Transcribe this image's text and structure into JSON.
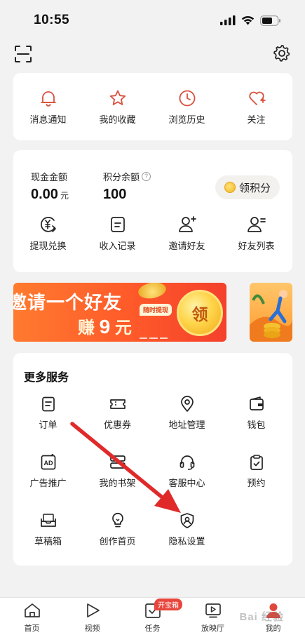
{
  "status_bar": {
    "time": "10:55"
  },
  "top_bar": {
    "scan_icon": "scan-icon",
    "settings_icon": "gear-icon"
  },
  "quick_actions": [
    {
      "label": "消息通知",
      "icon": "bell-icon"
    },
    {
      "label": "我的收藏",
      "icon": "star-icon"
    },
    {
      "label": "浏览历史",
      "icon": "clock-icon"
    },
    {
      "label": "关注",
      "icon": "heart-plus-icon"
    }
  ],
  "wallet": {
    "cash_label": "现金金额",
    "cash_value": "0.00",
    "cash_unit": "元",
    "points_label": "积分余额",
    "points_value": "100",
    "claim_button": "领积分",
    "actions": [
      {
        "label": "提现兑换",
        "icon": "yen-exchange-icon"
      },
      {
        "label": "收入记录",
        "icon": "record-icon"
      },
      {
        "label": "邀请好友",
        "icon": "add-user-icon"
      },
      {
        "label": "好友列表",
        "icon": "user-list-icon"
      }
    ]
  },
  "banner": {
    "title": "邀请一个好友",
    "earn_prefix": "赚",
    "earn_amount": "9",
    "earn_unit": "元",
    "tag": "随时提现",
    "coin_text": "领"
  },
  "more_services": {
    "title": "更多服务",
    "items": [
      {
        "label": "订单",
        "icon": "order-icon"
      },
      {
        "label": "优惠券",
        "icon": "coupon-icon"
      },
      {
        "label": "地址管理",
        "icon": "location-icon"
      },
      {
        "label": "钱包",
        "icon": "wallet-icon"
      },
      {
        "label": "广告推广",
        "icon": "ad-icon"
      },
      {
        "label": "我的书架",
        "icon": "bookshelf-icon"
      },
      {
        "label": "客服中心",
        "icon": "headset-icon"
      },
      {
        "label": "预约",
        "icon": "appointment-icon"
      },
      {
        "label": "草稿箱",
        "icon": "draft-box-icon"
      },
      {
        "label": "创作首页",
        "icon": "lightbulb-icon"
      },
      {
        "label": "隐私设置",
        "icon": "privacy-shield-icon"
      }
    ]
  },
  "tab_bar": {
    "tabs": [
      {
        "label": "首页",
        "icon": "home-icon"
      },
      {
        "label": "视频",
        "icon": "play-icon"
      },
      {
        "label": "任务",
        "icon": "task-icon",
        "badge": "开宝箱"
      },
      {
        "label": "放映厅",
        "icon": "screen-play-icon"
      },
      {
        "label": "我的",
        "icon": "profile-icon"
      }
    ]
  },
  "colors": {
    "accent": "#d9503f",
    "arrow": "#e02a2a",
    "banner": "#ff5a2a"
  },
  "watermark": "Bai 经验"
}
